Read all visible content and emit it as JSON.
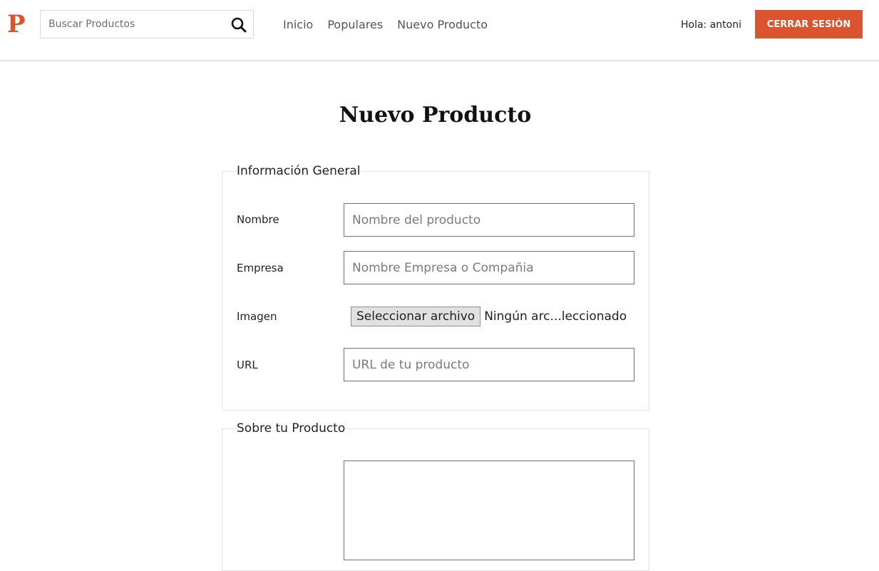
{
  "header": {
    "logo": "P",
    "search": {
      "placeholder": "Buscar Productos"
    },
    "nav": [
      {
        "label": "Inicio"
      },
      {
        "label": "Populares"
      },
      {
        "label": "Nuevo Producto"
      }
    ],
    "greeting": "Hola: antoni",
    "logout_label": "Cerrar Sesión"
  },
  "icons": {
    "search": "search-icon"
  },
  "colors": {
    "accent": "#da552f",
    "border": "#e1e1e1"
  },
  "page": {
    "title": "Nuevo Producto"
  },
  "form": {
    "general": {
      "legend": "Información General",
      "name": {
        "label": "Nombre",
        "placeholder": "Nombre del producto"
      },
      "company": {
        "label": "Empresa",
        "placeholder": "Nombre Empresa o Compañia"
      },
      "image": {
        "label": "Imagen",
        "button": "Seleccionar archivo",
        "status": "Ningún arc...leccionado"
      },
      "url": {
        "label": "URL",
        "placeholder": "URL de tu producto"
      }
    },
    "about": {
      "legend": "Sobre tu Producto"
    }
  }
}
